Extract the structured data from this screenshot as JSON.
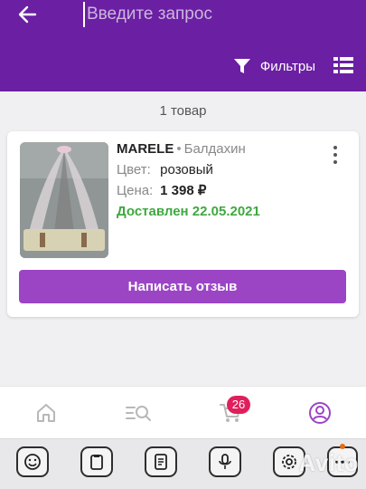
{
  "header": {
    "search_placeholder": "Введите запрос",
    "filters_label": "Фильтры",
    "background_color": "#6b1fa3"
  },
  "results": {
    "count_label": "1 товар"
  },
  "order": {
    "brand": "MARELE",
    "separator": "•",
    "category": "Балдахин",
    "color_label": "Цвет:",
    "color_value": "розовый",
    "price_label": "Цена:",
    "price_value": "1 398 ₽",
    "status": "Доставлен 22.05.2021",
    "review_button": "Написать отзыв",
    "button_color": "#9b45c5",
    "status_color": "#3fa83f"
  },
  "bottom_nav": {
    "items": [
      "home-icon",
      "catalog-search-icon",
      "cart-icon",
      "profile-icon"
    ],
    "cart_badge": "26",
    "active_color": "#9b45c5"
  },
  "keyboard_bar": {
    "keys": [
      "emoji-icon",
      "clipboard-icon",
      "notes-icon",
      "microphone-icon",
      "settings-icon",
      "more-icon"
    ]
  },
  "watermark": {
    "text": "Avito"
  }
}
